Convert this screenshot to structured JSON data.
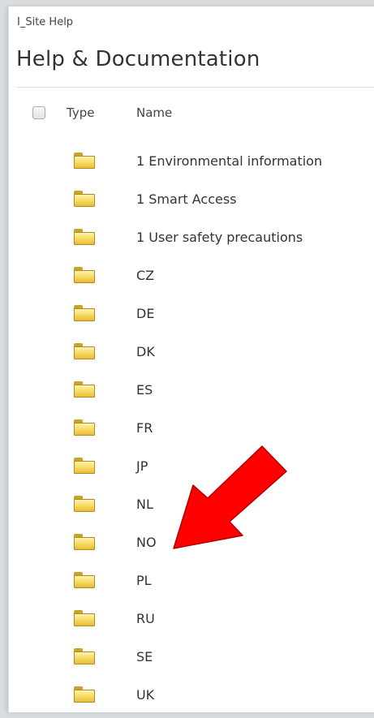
{
  "breadcrumb": "I_Site Help",
  "title": "Help & Documentation",
  "columns": {
    "type": "Type",
    "name": "Name"
  },
  "items": [
    {
      "name": "1 Environmental information",
      "icon": "folder-icon"
    },
    {
      "name": "1 Smart Access",
      "icon": "folder-icon"
    },
    {
      "name": "1 User safety precautions",
      "icon": "folder-icon"
    },
    {
      "name": "CZ",
      "icon": "folder-icon"
    },
    {
      "name": "DE",
      "icon": "folder-icon"
    },
    {
      "name": "DK",
      "icon": "folder-icon"
    },
    {
      "name": "ES",
      "icon": "folder-icon"
    },
    {
      "name": "FR",
      "icon": "folder-icon"
    },
    {
      "name": "JP",
      "icon": "folder-icon"
    },
    {
      "name": "NL",
      "icon": "folder-icon"
    },
    {
      "name": "NO",
      "icon": "folder-icon"
    },
    {
      "name": "PL",
      "icon": "folder-icon"
    },
    {
      "name": "RU",
      "icon": "folder-icon"
    },
    {
      "name": "SE",
      "icon": "folder-icon"
    },
    {
      "name": "UK",
      "icon": "folder-icon"
    }
  ],
  "annotation": {
    "icon": "red-arrow-icon",
    "points_to": "NO",
    "color": "#ff0000"
  },
  "colors": {
    "folder": "#f4d160",
    "text": "#333333"
  }
}
